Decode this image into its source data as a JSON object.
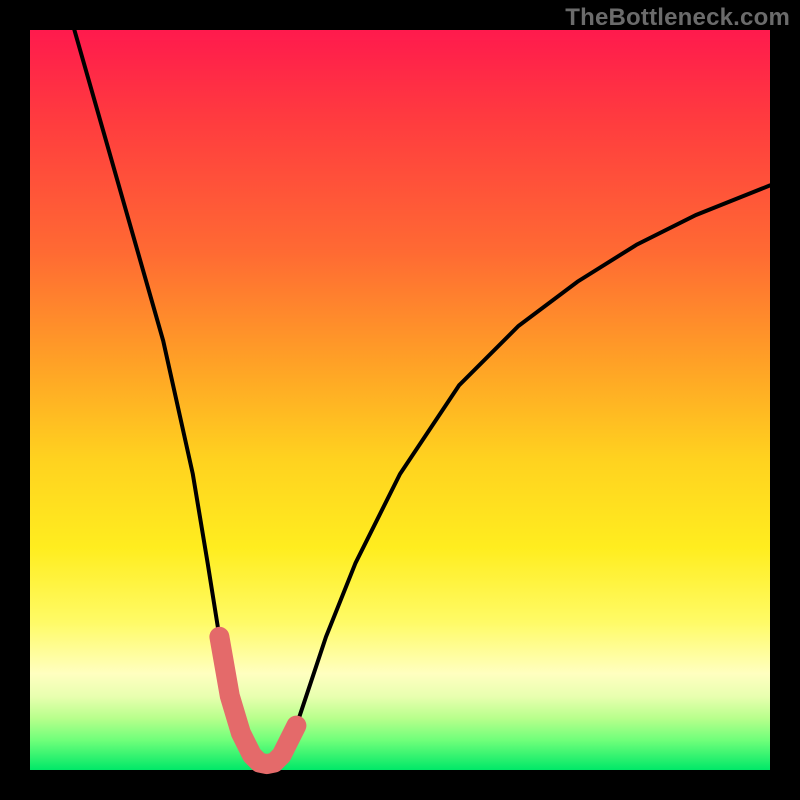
{
  "watermark": "TheBottleneck.com",
  "colors": {
    "background": "#000000",
    "gradient_top": "#ff1a4d",
    "gradient_bottom": "#00e868",
    "curve_stroke": "#000000",
    "highlight_stroke": "#e46a6a",
    "highlight_fill": "#e46a6a"
  },
  "chart_data": {
    "type": "line",
    "title": "",
    "xlabel": "",
    "ylabel": "",
    "xlim": [
      0,
      100
    ],
    "ylim": [
      0,
      100
    ],
    "grid": false,
    "series": [
      {
        "name": "bottleneck-curve",
        "x": [
          6,
          10,
          14,
          18,
          22,
          24,
          25.6,
          27,
          28.5,
          30,
          31,
          32,
          33,
          34,
          36,
          38,
          40,
          44,
          50,
          58,
          66,
          74,
          82,
          90,
          100
        ],
        "y": [
          100,
          86,
          72,
          58,
          40,
          28,
          18,
          10,
          5,
          2,
          1,
          0.8,
          1,
          2,
          6,
          12,
          18,
          28,
          40,
          52,
          60,
          66,
          71,
          75,
          79
        ]
      }
    ],
    "highlight_segment": {
      "description": "Thick salmon segment near the valley minimum with endpoint markers",
      "x": [
        25.6,
        27,
        28.5,
        30,
        31,
        32,
        33,
        34,
        36
      ],
      "y": [
        18,
        10,
        5,
        2,
        1,
        0.8,
        1,
        2,
        6
      ],
      "markers_x": [
        25.6,
        36
      ],
      "markers_y": [
        18,
        6
      ]
    },
    "background_heatmap": {
      "description": "Vertical gradient encoding bottleneck severity",
      "stops": [
        {
          "pos": 0.0,
          "color": "#ff1a4d"
        },
        {
          "pos": 0.12,
          "color": "#ff3b3f"
        },
        {
          "pos": 0.3,
          "color": "#ff6a33"
        },
        {
          "pos": 0.45,
          "color": "#ffa126"
        },
        {
          "pos": 0.58,
          "color": "#ffd21f"
        },
        {
          "pos": 0.7,
          "color": "#ffed1f"
        },
        {
          "pos": 0.8,
          "color": "#fffb66"
        },
        {
          "pos": 0.87,
          "color": "#ffffc0"
        },
        {
          "pos": 0.9,
          "color": "#e9ffb0"
        },
        {
          "pos": 0.93,
          "color": "#b8ff8c"
        },
        {
          "pos": 0.96,
          "color": "#6fff7a"
        },
        {
          "pos": 1.0,
          "color": "#00e868"
        }
      ]
    }
  }
}
